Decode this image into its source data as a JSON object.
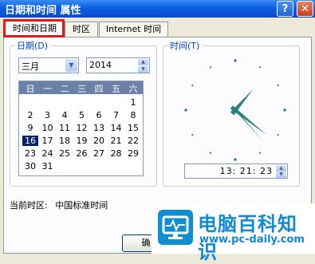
{
  "window": {
    "title": "日期和时间 属性",
    "help_glyph": "?",
    "close_glyph": "✕"
  },
  "tabs": [
    {
      "label": "时间和日期",
      "active": true
    },
    {
      "label": "时区",
      "active": false
    },
    {
      "label": "Internet 时间",
      "active": false
    }
  ],
  "date_group": {
    "legend": "日期(D)",
    "month": "三月",
    "year": "2014",
    "weekdays": [
      "日",
      "一",
      "二",
      "三",
      "四",
      "五",
      "六"
    ],
    "days": [
      "1",
      "2",
      "3",
      "4",
      "5",
      "6",
      "7",
      "8",
      "9",
      "10",
      "11",
      "12",
      "13",
      "14",
      "15",
      "16",
      "17",
      "18",
      "19",
      "20",
      "21",
      "22",
      "23",
      "24",
      "25",
      "26",
      "27",
      "28",
      "29",
      "30",
      "31"
    ],
    "first_weekday_index": 6,
    "selected_day": "16"
  },
  "time_group": {
    "legend": "时间(T)",
    "time": "13: 21: 23"
  },
  "timezone": {
    "label": "当前时区:",
    "value": "中国标准时间"
  },
  "buttons": {
    "ok_partial": "确"
  },
  "watermark": {
    "name": "电脑百科知识",
    "url": "www.pc-daily.com"
  },
  "colors": {
    "title_bar": "#0a5ee0",
    "highlight_frame": "#e01a1a",
    "calendar_header": "#6c81a6",
    "selected_day": "#0a246a",
    "clock_hands": "#2a7f7f"
  }
}
